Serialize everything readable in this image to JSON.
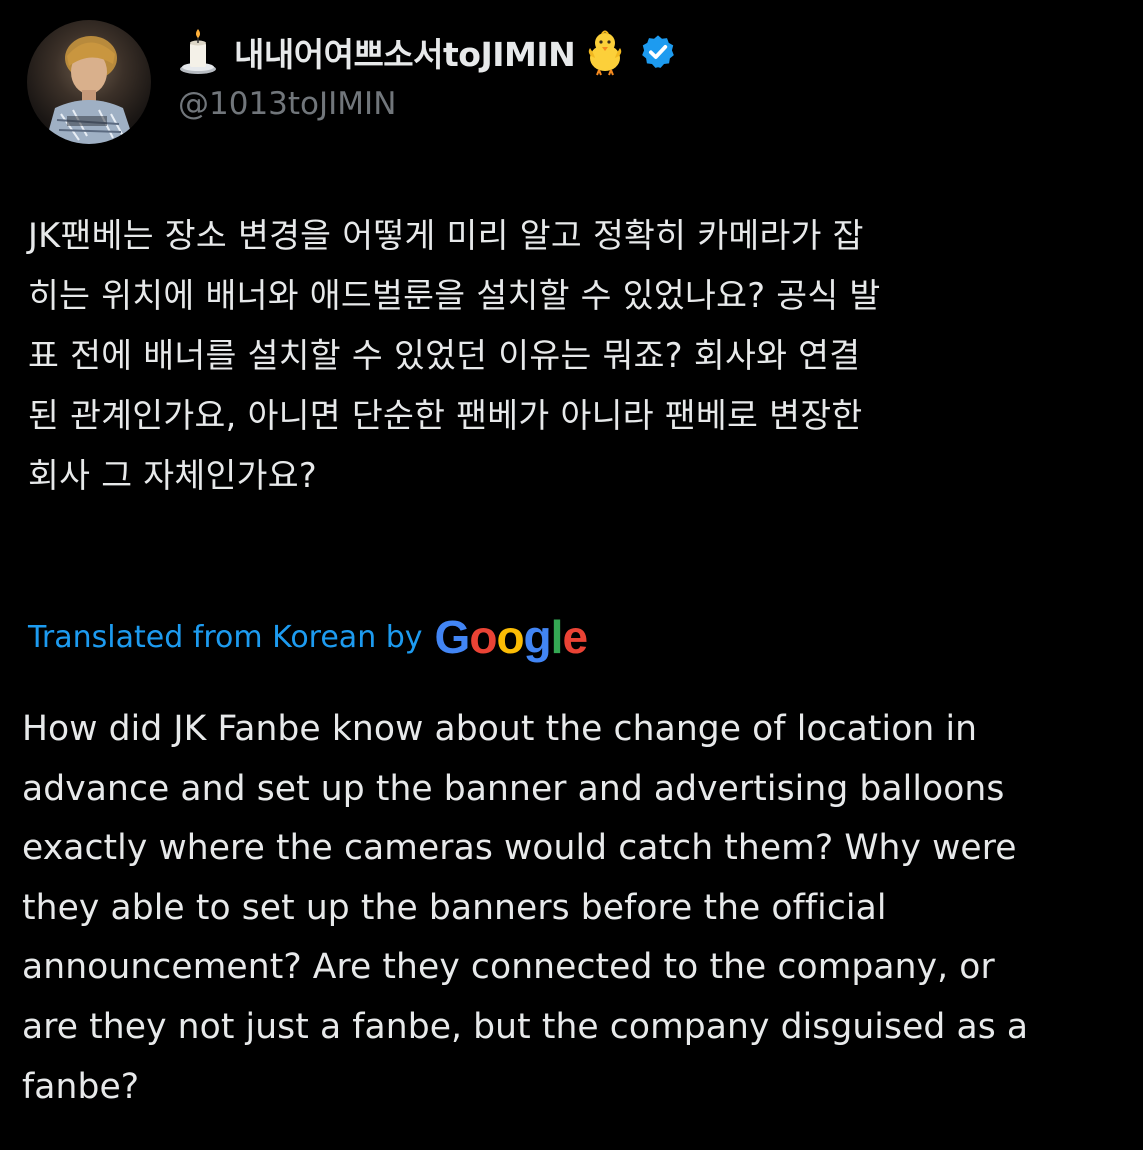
{
  "author": {
    "display_name": "내내어여쁘소서toJIMIN",
    "handle": "@1013toJIMIN",
    "name_prefix_icon": "candle-icon",
    "name_suffix_icon": "baby-chick-icon",
    "verified_icon": "verified-badge-icon",
    "verified_color": "#1d9bf0"
  },
  "tweet": {
    "original_lines": [
      "JK팬베는 장소 변경을 어떻게 미리 알고 정확히 카메라가 잡",
      "히는 위치에 배너와 애드벌룬을 설치할 수 있었나요? 공식 발",
      "표 전에 배너를 설치할 수 있었던 이유는 뭐죠? 회사와 연결",
      "된 관계인가요, 아니면 단순한 팬베가 아니라 팬베로 변장한",
      "회사 그 자체인가요?"
    ],
    "translated_by_label": "Translated from Korean by",
    "translation_provider": "Google",
    "translation_lines": [
      "How did JK Fanbe know about the change of location in",
      "advance and set up the banner and advertising balloons",
      "exactly where the cameras would catch them? Why were",
      "they able to set up the banners before the official",
      "announcement? Are they connected to the company, or",
      "are they not just a fanbe, but the company disguised as a",
      "fanbe?"
    ]
  },
  "colors": {
    "background": "#000000",
    "text_primary": "#e7e9ea",
    "text_secondary": "#71767b",
    "link_blue": "#1d9bf0",
    "google_blue": "#4285f4",
    "google_red": "#ea4335",
    "google_yellow": "#fbbc05",
    "google_green": "#34a853"
  }
}
